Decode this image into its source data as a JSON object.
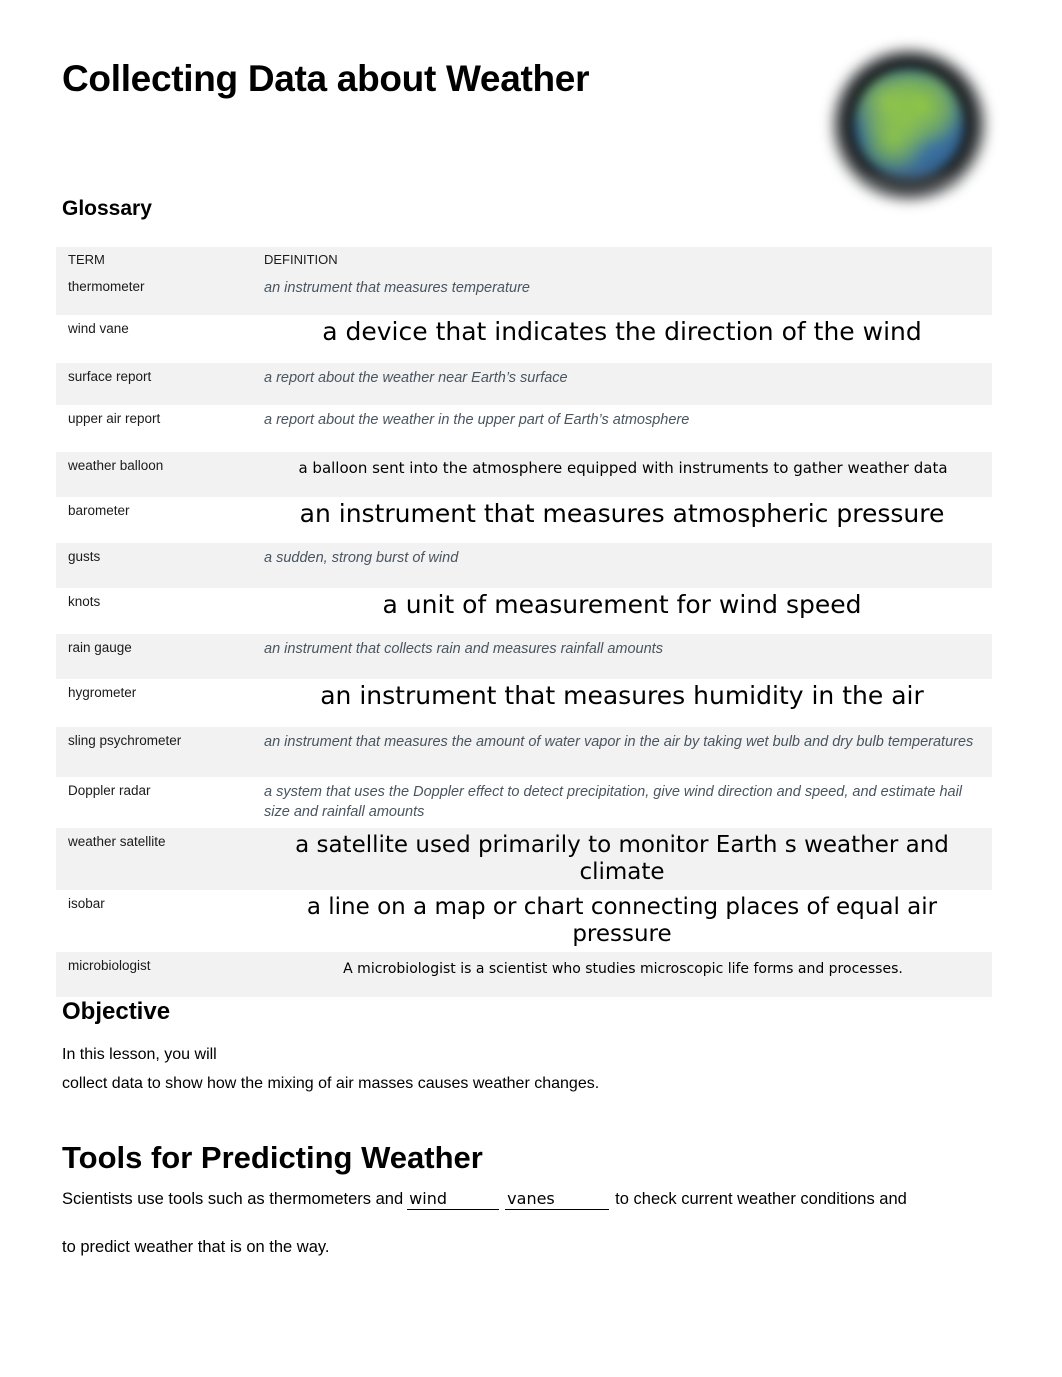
{
  "document": {
    "title": "Collecting Data about Weather",
    "globe_icon": "earth-globe-icon"
  },
  "glossary": {
    "heading": "Glossary",
    "columns": {
      "term": "TERM",
      "definition": "DEFINITION"
    },
    "rows": [
      {
        "term": "thermometer",
        "definition": "an instrument that measures temperature",
        "style": "original"
      },
      {
        "term": "wind vane",
        "definition": "a device that indicates the direction of the wind",
        "style": "filled-xl"
      },
      {
        "term": "surface report",
        "definition": "a report about the weather near Earth’s surface",
        "style": "original"
      },
      {
        "term": "upper air report",
        "definition": "a report about the weather in the upper part of Earth’s atmosphere",
        "style": "original"
      },
      {
        "term": "weather balloon",
        "definition": "a balloon sent into the atmosphere equipped with instruments to gather weather data",
        "style": "filled-md"
      },
      {
        "term": "barometer",
        "definition": "an instrument that measures atmospheric pressure",
        "style": "filled-xl"
      },
      {
        "term": "gusts",
        "definition": "a sudden, strong burst of wind",
        "style": "original"
      },
      {
        "term": "knots",
        "definition": "a unit of measurement for wind speed",
        "style": "filled-xl"
      },
      {
        "term": "rain gauge",
        "definition": "an instrument that collects rain and measures rainfall amounts",
        "style": "original"
      },
      {
        "term": "hygrometer",
        "definition": "an instrument that measures humidity in the air",
        "style": "filled-xl"
      },
      {
        "term": "sling psychrometer",
        "definition": "an instrument that measures the amount of water vapor in the air by taking wet bulb and dry bulb temperatures",
        "style": "original"
      },
      {
        "term": "Doppler radar",
        "definition": "a system that uses the Doppler effect to detect precipitation, give wind direction and speed, and estimate hail size and rainfall amounts",
        "style": "original"
      },
      {
        "term": "weather satellite",
        "definition": "a satellite used primarily to monitor Earth   s weather and climate",
        "style": "filled-lg"
      },
      {
        "term": "isobar",
        "definition": "a line on a map or chart connecting places of equal air pressure",
        "style": "filled-lg"
      },
      {
        "term": "microbiologist",
        "definition": "A microbiologist is a scientist who studies microscopic life forms and processes.",
        "style": "filled-sm"
      }
    ]
  },
  "objective": {
    "heading": "Objective",
    "line1": "In this lesson, you will",
    "line2": "collect data to show how the mixing of air masses causes weather changes."
  },
  "tools": {
    "heading": "Tools for Predicting Weather",
    "text_before": "Scientists use tools such as thermometers and",
    "blank1": "wind",
    "blank2": "vanes",
    "text_after": "to check current weather conditions and",
    "line2": "to predict weather that is on the way."
  }
}
